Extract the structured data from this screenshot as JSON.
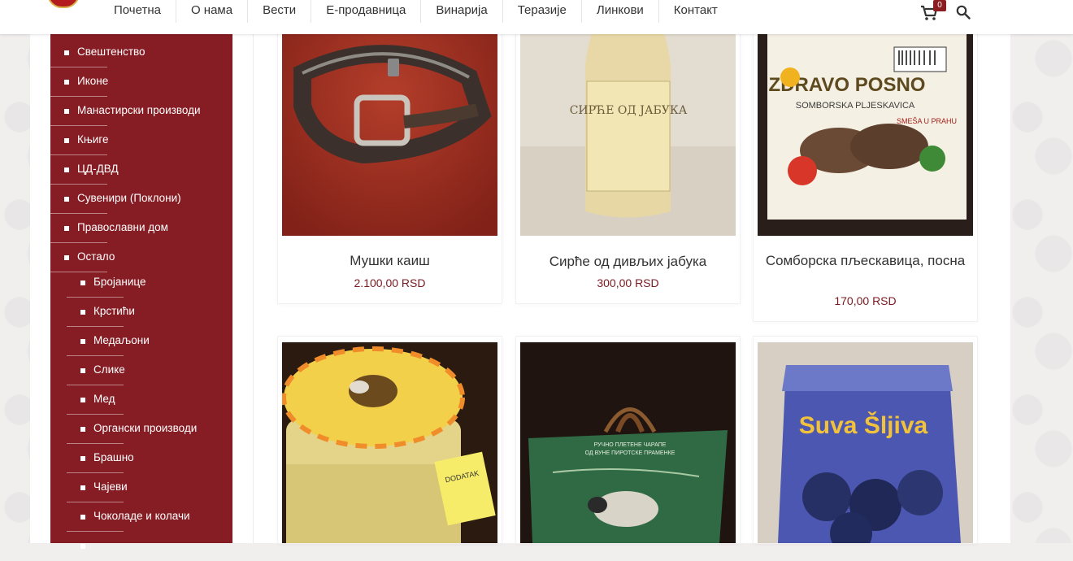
{
  "nav": {
    "items": [
      "Почетна",
      "О нама",
      "Вести",
      "Е-продавница",
      "Винарија",
      "Теразије",
      "Линкови",
      "Контакт"
    ],
    "cart_count": "0",
    "cart_icon": "cart-icon",
    "search_icon": "search-icon"
  },
  "sidebar": {
    "items": [
      {
        "label": "Свештенство",
        "level": 1
      },
      {
        "label": "Иконе",
        "level": 1
      },
      {
        "label": "Манастирски производи",
        "level": 1
      },
      {
        "label": "Књиге",
        "level": 1
      },
      {
        "label": "ЦД-ДВД",
        "level": 1
      },
      {
        "label": "Сувенири (Поклони)",
        "level": 1
      },
      {
        "label": "Православни дом",
        "level": 1
      },
      {
        "label": "Остало",
        "level": 1
      },
      {
        "label": "Бројанице",
        "level": 2
      },
      {
        "label": "Крстићи",
        "level": 2
      },
      {
        "label": "Медаљони",
        "level": 2
      },
      {
        "label": "Слике",
        "level": 2
      },
      {
        "label": "Мед",
        "level": 2
      },
      {
        "label": "Органски производи",
        "level": 2
      },
      {
        "label": "Брашно",
        "level": 2
      },
      {
        "label": "Чајеви",
        "level": 2
      },
      {
        "label": "Чоколаде и колачи",
        "level": 2
      }
    ]
  },
  "products": [
    {
      "title": "Мушки каиш",
      "price": "2.100,00 RSD"
    },
    {
      "title": "Сирће од дивљих јабука",
      "price": "300,00 RSD"
    },
    {
      "title": "Сомборска пљескавица, посна",
      "price": "170,00 RSD"
    },
    {
      "title": "",
      "price": ""
    },
    {
      "title": "",
      "price": ""
    },
    {
      "title": "",
      "price": ""
    }
  ],
  "product_images": {
    "p4_label": "DODATAK",
    "p5_line1": "РУЧНО ПЛЕТЕНЕ ЧАРАПЕ",
    "p5_line2": "ОД ВУНЕ ПИРОТСКЕ ПРАМЕНКЕ",
    "p6_brand": "Suva Šljiva",
    "p3_brand": "ZDRAVO POSNO",
    "p3_sub": "SOMBORSKA PLJESKAVICA",
    "p3_tag": "SMEŠA U PRAHU",
    "p2_label": "СИРЋЕ ОД ЈАБУКА"
  },
  "colors": {
    "accent": "#861d24",
    "price": "#7a1a20"
  }
}
